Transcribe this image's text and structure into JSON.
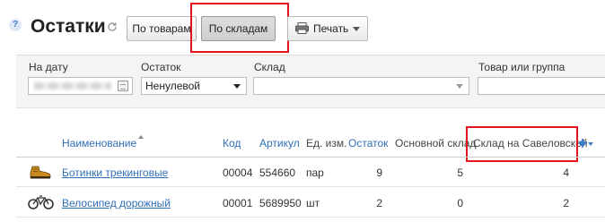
{
  "header": {
    "help_glyph": "?",
    "title": "Остатки"
  },
  "toolbar": {
    "by_products_label": "По товарам",
    "by_warehouses_label": "По складам",
    "print_label": "Печать"
  },
  "filters": {
    "date_label": "На дату",
    "stock_label": "Остаток",
    "stock_value": "Ненулевой",
    "warehouse_label": "Склад",
    "warehouse_value": "",
    "product_label": "Товар или группа",
    "product_value": ""
  },
  "table": {
    "columns": {
      "name": "Наименование",
      "code": "Код",
      "article": "Артикул",
      "unit": "Ед. изм.",
      "stock": "Остаток",
      "main_warehouse": "Основной склад",
      "savelovskaya": "Склад на Савеловской"
    },
    "rows": [
      {
        "icon": "boot-icon",
        "name": "Ботинки трекинговые",
        "code": "00004",
        "article": "554660",
        "unit": "пар",
        "stock": "9",
        "main_warehouse": "5",
        "savelovskaya": "4"
      },
      {
        "icon": "bicycle-icon",
        "name": "Велосипед дорожный",
        "code": "00001",
        "article": "5689950",
        "unit": "шт",
        "stock": "2",
        "main_warehouse": "0",
        "savelovskaya": "2"
      }
    ]
  },
  "colors": {
    "accent": "#2f6fb8",
    "highlight": "#e0141e"
  }
}
